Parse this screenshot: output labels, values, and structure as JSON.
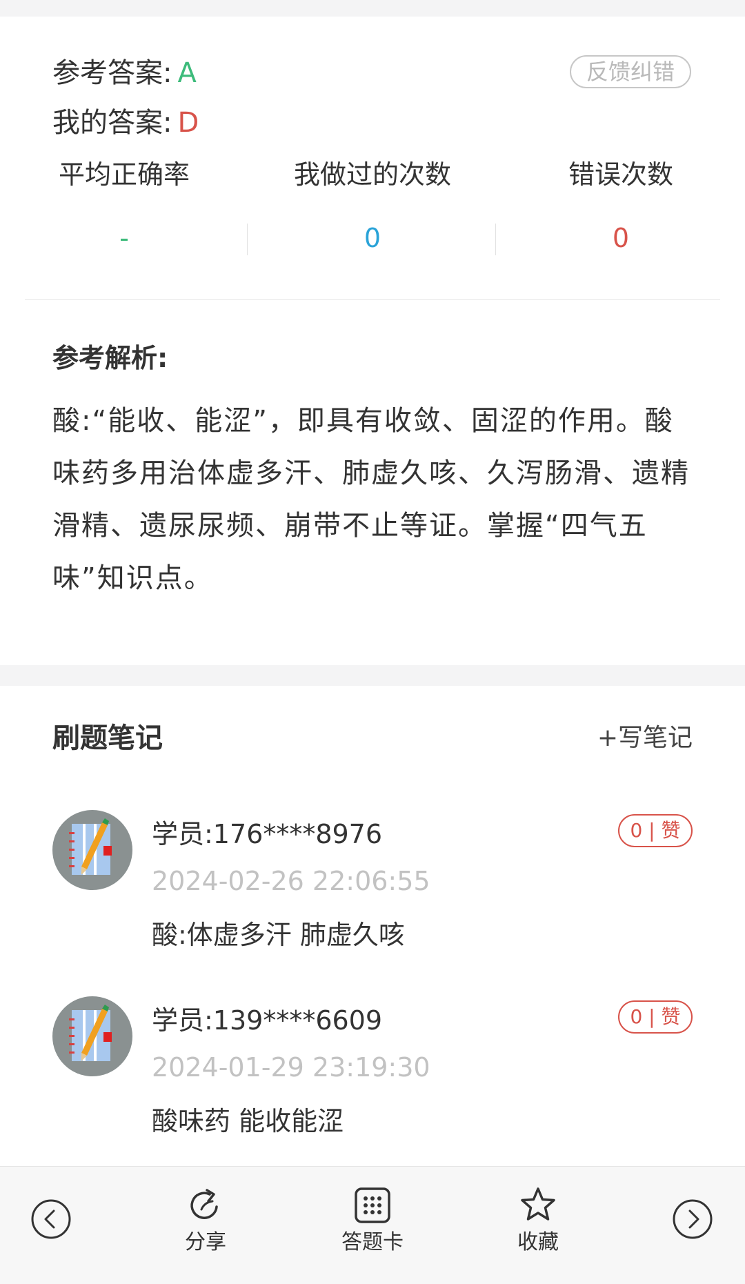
{
  "answer": {
    "reference_label": "参考答案:",
    "reference_value": "A",
    "mine_label": "我的答案:",
    "mine_value": "D",
    "feedback_button": "反馈纠错"
  },
  "stats": [
    {
      "label": "平均正确率",
      "value": "-"
    },
    {
      "label": "我做过的次数",
      "value": "0"
    },
    {
      "label": "错误次数",
      "value": "0"
    }
  ],
  "analysis": {
    "title": "参考解析:",
    "body": "酸:“能收、能涩”，即具有收敛、固涩的作用。酸味药多用治体虚多汗、肺虚久咳、久泻肠滑、遗精滑精、遗尿尿频、崩带不止等证。掌握“四气五味”知识点。"
  },
  "notes": {
    "title": "刷题笔记",
    "write_label": "+写笔记",
    "items": [
      {
        "user": "学员:176****8976",
        "time": "2024-02-26 22:06:55",
        "text": "酸:体虚多汗  肺虚久咳",
        "like": "0 | 赞"
      },
      {
        "user": "学员:139****6609",
        "time": "2024-01-29 23:19:30",
        "text": "酸味药 能收能涩",
        "like": "0 | 赞"
      }
    ]
  },
  "bottom_bar": {
    "prev_icon": "chevron-left-circle-icon",
    "share_label": "分享",
    "card_label": "答题卡",
    "favorite_label": "收藏",
    "next_icon": "chevron-right-circle-icon"
  }
}
